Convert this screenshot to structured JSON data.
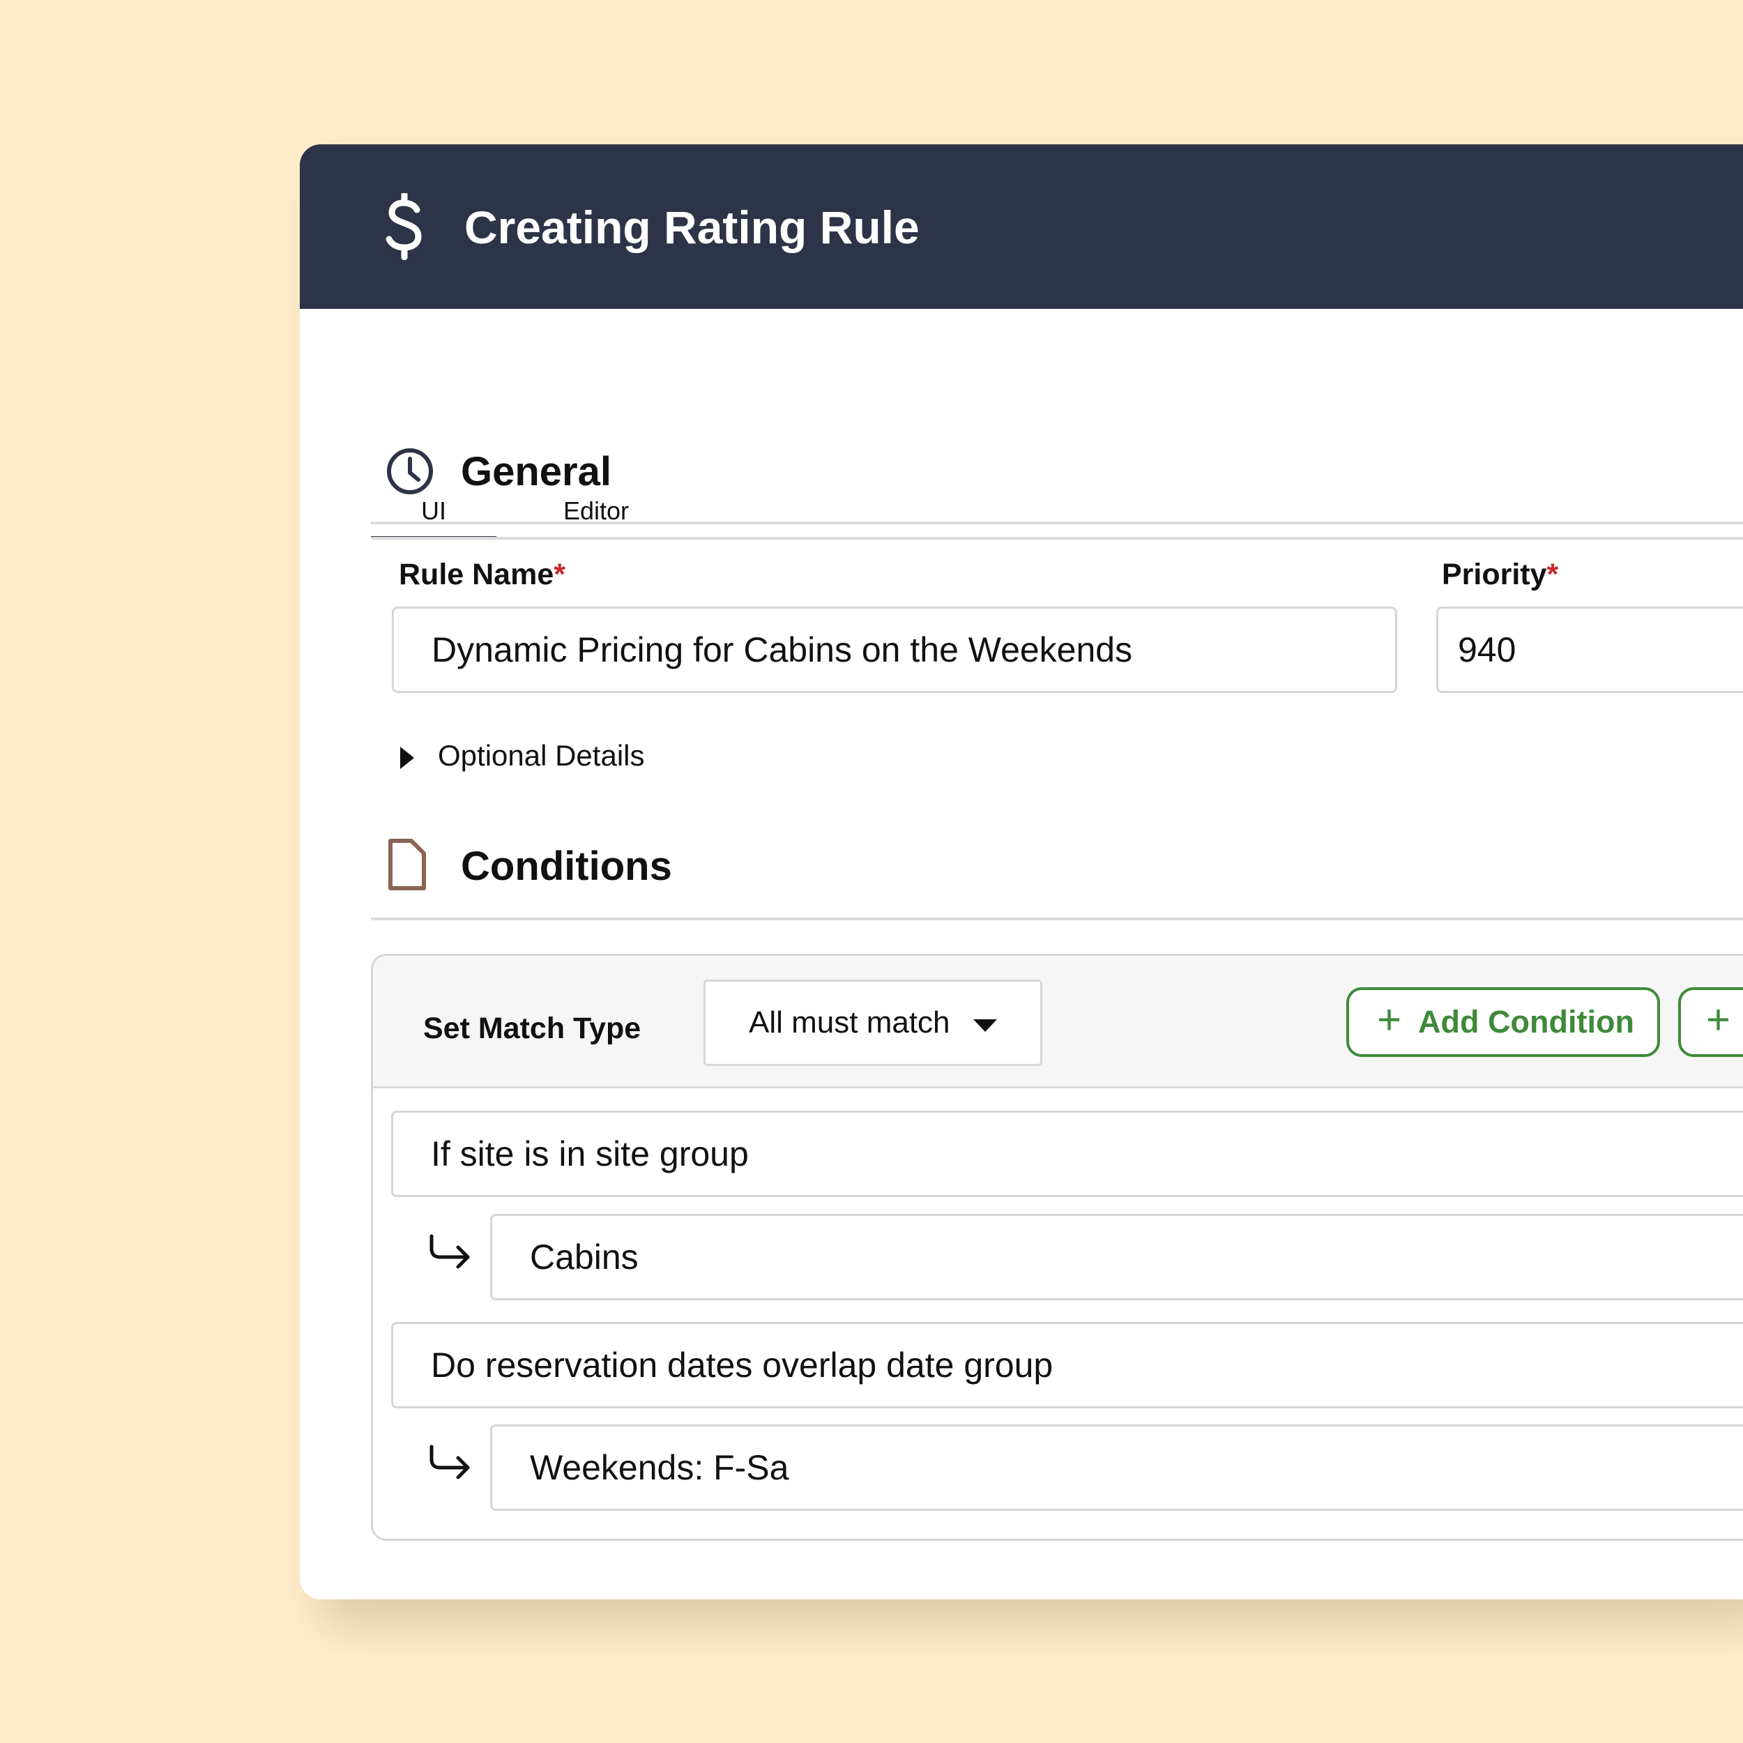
{
  "header": {
    "icon": "dollar-icon",
    "title": "Creating Rating Rule"
  },
  "tabs": [
    {
      "label": "UI",
      "active": true
    },
    {
      "label": "Editor",
      "active": false
    }
  ],
  "general": {
    "icon": "clock-icon",
    "title": "General",
    "rule_name": {
      "label": "Rule Name",
      "required_mark": "*",
      "value": "Dynamic Pricing for Cabins on the Weekends"
    },
    "priority": {
      "label": "Priority",
      "required_mark": "*",
      "value": "940"
    },
    "optional_details": "Optional Details"
  },
  "conditions": {
    "icon": "document-icon",
    "title": "Conditions",
    "match_type_label": "Set Match Type",
    "match_type_value": "All must match",
    "add_condition_label": "Add Condition",
    "add_plus": "+",
    "rows": [
      {
        "condition": "If site is in site group",
        "value": "Cabins"
      },
      {
        "condition": "Do reservation dates overlap date group",
        "value": "Weekends: F-Sa"
      }
    ]
  },
  "colors": {
    "header_bg": "#2e3447",
    "page_bg": "#feeccb",
    "accent_green": "#3f8a3a",
    "required_red": "#c62828",
    "doc_icon": "#8a6454"
  }
}
